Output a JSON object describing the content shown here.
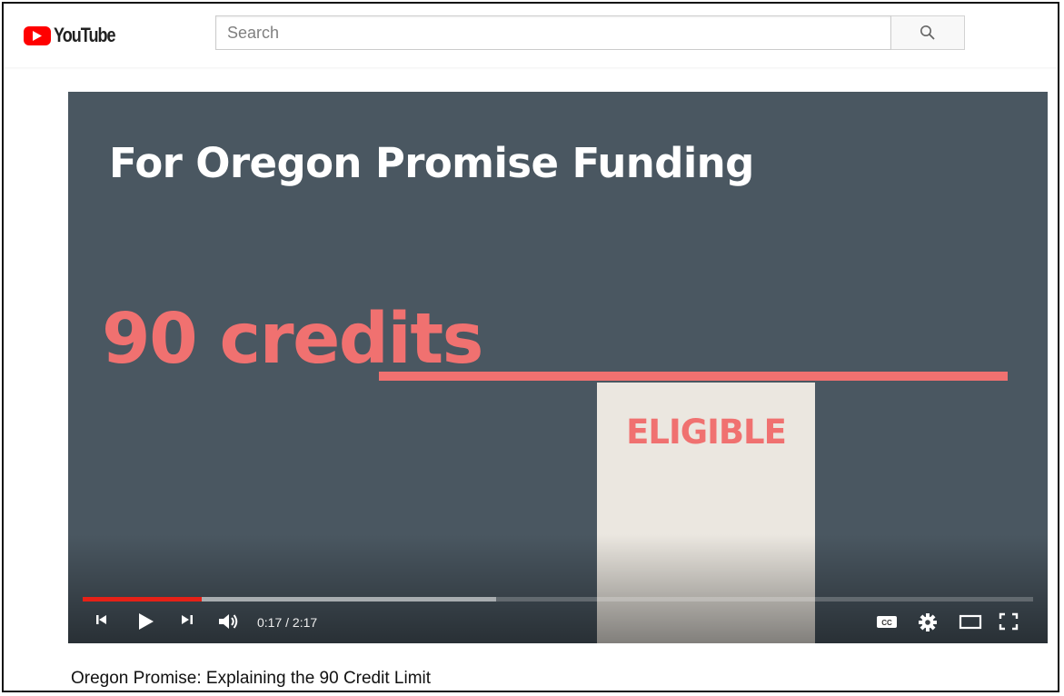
{
  "header": {
    "logo_text": "YouTube",
    "search_placeholder": "Search"
  },
  "video": {
    "slide": {
      "heading": "For Oregon Promise Funding",
      "credits_text": "90 credits",
      "eligible_label": "ELIGIBLE"
    },
    "player": {
      "current_time": "0:17",
      "duration": "2:17",
      "time_display": "0:17 / 2:17",
      "played_fraction": 0.125,
      "buffered_fraction": 0.435
    },
    "title": "Oregon Promise: Explaining the 90 Credit Limit"
  },
  "colors": {
    "brand_red": "#ff0000",
    "progress_red": "#e62117",
    "slide_background": "#4a5761",
    "accent_coral": "#f07170",
    "eligible_box": "#ebe7e0"
  },
  "icons": [
    "youtube-play-icon",
    "search-icon",
    "previous-icon",
    "play-icon",
    "next-icon",
    "volume-icon",
    "captions-icon",
    "settings-gear-icon",
    "theater-mode-icon",
    "fullscreen-icon"
  ]
}
